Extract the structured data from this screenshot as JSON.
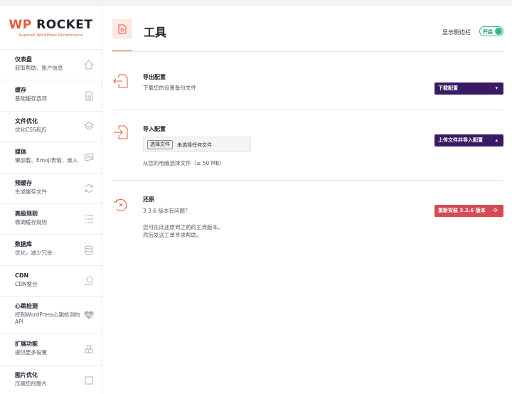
{
  "logo": {
    "wp": "WP",
    "rocket": "ROCKET",
    "tagline": "Superior WordPress Performance"
  },
  "sidebar": {
    "items": [
      {
        "title": "仪表盘",
        "desc": "获取帮助、账户信息",
        "icon": "home-icon"
      },
      {
        "title": "缓存",
        "desc": "基础缓存选项",
        "icon": "file-icon"
      },
      {
        "title": "文件优化",
        "desc": "优化CSS和JS",
        "icon": "layers-icon"
      },
      {
        "title": "媒体",
        "desc": "懒加载、Emoji表情、嵌入",
        "icon": "image-icon"
      },
      {
        "title": "预缓存",
        "desc": "生成缓存文件",
        "icon": "refresh-icon"
      },
      {
        "title": "高级规则",
        "desc": "微调缓存规则",
        "icon": "list-icon"
      },
      {
        "title": "数据库",
        "desc": "优化，减少冗余",
        "icon": "database-icon"
      },
      {
        "title": "CDN",
        "desc": "CDN整合",
        "icon": "cdn-icon"
      },
      {
        "title": "心跳检测",
        "desc": "控制WordPress心跳检测的API",
        "icon": "heartbeat-icon"
      },
      {
        "title": "扩展功能",
        "desc": "提供更多设置",
        "icon": "addons-icon"
      },
      {
        "title": "图片优化",
        "desc": "压缩您的图片",
        "icon": "compress-icon"
      }
    ]
  },
  "header": {
    "title": "工具",
    "sidebar_toggle_label": "显示侧边栏",
    "toggle_state": "开启"
  },
  "export": {
    "title": "导出配置",
    "desc": "下载您的设置备份文件",
    "button": "下载配置"
  },
  "import": {
    "title": "导入配置",
    "file_button": "选择文件",
    "file_status": "未选择任何文件",
    "hint": "从您的电脑选择文件（≤ 50 MB）",
    "button": "上传文件并导入配置"
  },
  "rollback": {
    "title": "还原",
    "question": "3.3.6 版本有问题？",
    "desc_line1": "您可在此还原到之前的主流版本。",
    "desc_line2": "然后发送工单寻求帮助。",
    "button": "重新安装 3.2.6 版本"
  },
  "colors": {
    "accent": "#e45b3a",
    "purple": "#3a1b63",
    "red": "#d54a53",
    "green": "#35b58c"
  }
}
